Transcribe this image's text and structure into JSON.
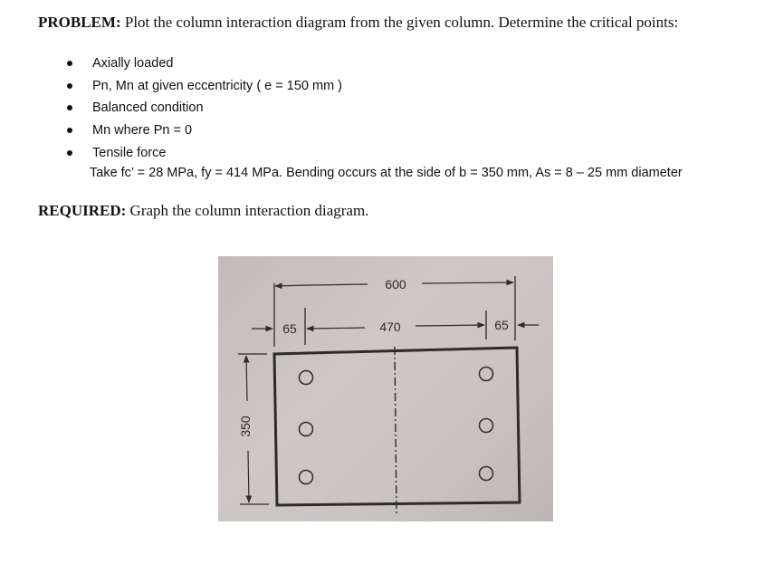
{
  "problem": {
    "label": "PROBLEM:",
    "text": "Plot the column interaction diagram from the given column. Determine the critical points:"
  },
  "critical_points": [
    "Axially loaded",
    "Pn, Mn at given eccentricity ( e = 150 mm )",
    "Balanced condition",
    "Mn where Pn = 0",
    "Tensile force"
  ],
  "given": "Take fc’ = 28 MPa, fy = 414 MPa. Bending occurs at the side of b = 350 mm, As = 8 – 25 mm diameter",
  "required": {
    "label": "REQUIRED:",
    "text": "Graph the column interaction diagram."
  },
  "figure": {
    "overall_width_label": "600",
    "cover_left_label": "65",
    "bar_spacing_label": "470",
    "cover_right_label": "65",
    "height_label": "350",
    "rebar_rows": 3,
    "rebar_cols": 2,
    "colors": {
      "background": "#c9c3c2",
      "lines": "#2e2b2b"
    }
  }
}
